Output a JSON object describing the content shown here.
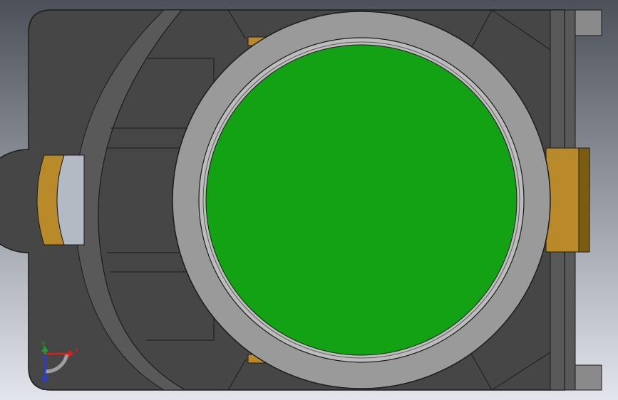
{
  "viewport": {
    "background_top": "#4c5159",
    "background_bottom": "#e2e6ec"
  },
  "colors": {
    "housing_dark": "#3b3b3b",
    "housing_mid": "#464646",
    "housing_light": "#595959",
    "edge": "#1b1b1b",
    "ring_outer": "#9a9a9a",
    "ring_inner": "#bdbdbd",
    "button_green": "#12a214",
    "gold": "#b88a2a",
    "gold_dark": "#7e5c0f",
    "bracket": "#8a8a8a",
    "lens": "#b4bac4"
  },
  "orientation_triad": {
    "x_label": "X",
    "y_label": "Y",
    "z_label": "Z",
    "x_color": "#d42020",
    "y_color": "#1fa02a",
    "z_color": "#2a3fcf",
    "x_icon": "arrow-right-icon",
    "y_icon": "arrow-up-icon",
    "z_icon": "arrow-down-icon"
  }
}
